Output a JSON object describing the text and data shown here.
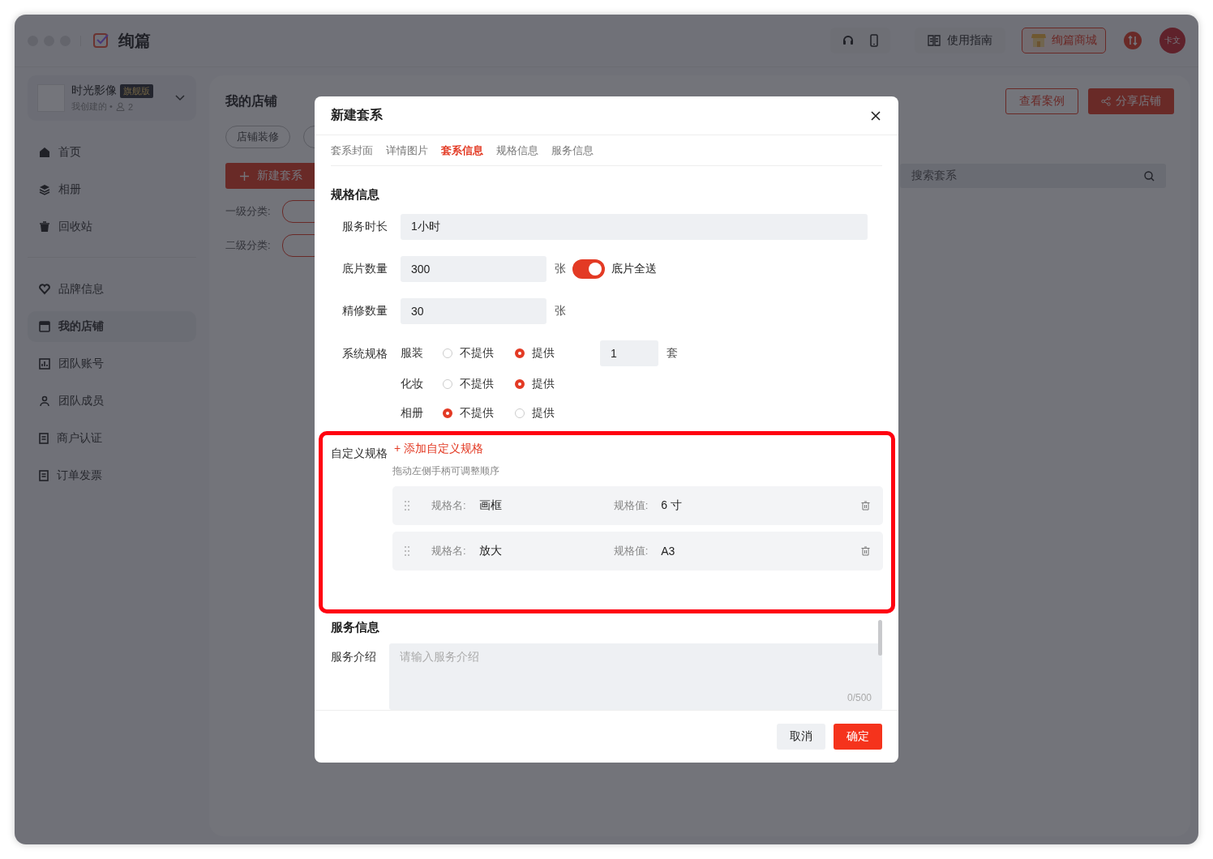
{
  "window": {
    "app_name": "绚篇"
  },
  "top_bar": {
    "guide_button": "使用指南",
    "mall_button": "绚篇商城",
    "avatar": "卡文"
  },
  "account": {
    "name": "时光影像",
    "badge": "旗舰版",
    "meta": "我创建的 •",
    "member_count": "2"
  },
  "sidebar": {
    "groups": [
      [
        {
          "label": "首页",
          "selected": false
        },
        {
          "label": "相册",
          "selected": false
        },
        {
          "label": "回收站",
          "selected": false
        }
      ],
      [
        {
          "label": "品牌信息",
          "selected": false
        },
        {
          "label": "我的店铺",
          "selected": true
        },
        {
          "label": "团队账号",
          "selected": false
        },
        {
          "label": "团队成员",
          "selected": false
        },
        {
          "label": "商户认证",
          "selected": false
        },
        {
          "label": "订单发票",
          "selected": false
        }
      ]
    ]
  },
  "main": {
    "title": "我的店铺",
    "tabs": [
      "店铺装修"
    ],
    "new_button": "新建套系",
    "filters": [
      "一级分类:",
      "二级分类:"
    ],
    "case_button": "查看案例",
    "share_button": "分享店铺",
    "search": {
      "placeholder": "搜索套系"
    }
  },
  "dialog": {
    "title": "新建套系",
    "tabs": [
      {
        "label": "套系封面",
        "selected": false
      },
      {
        "label": "详情图片",
        "selected": false
      },
      {
        "label": "套系信息",
        "selected": true
      },
      {
        "label": "规格信息",
        "selected": false
      },
      {
        "label": "服务信息",
        "selected": false
      }
    ],
    "section_title": "规格信息",
    "duration": {
      "label": "服务时长",
      "value": "1小时"
    },
    "raw_count": {
      "label": "底片数量",
      "value": "300",
      "unit": "张",
      "toggle": {
        "on": true,
        "label": "底片全送"
      }
    },
    "retouch_count": {
      "label": "精修数量",
      "value": "30",
      "unit": "张"
    },
    "system_spec": {
      "label": "系统规格",
      "rows": [
        {
          "name": "服装",
          "options": [
            {
              "label": "不提供",
              "selected": false
            },
            {
              "label": "提供",
              "selected": true
            }
          ],
          "quantity": "1",
          "unit": "套"
        },
        {
          "name": "化妆",
          "options": [
            {
              "label": "不提供",
              "selected": false
            },
            {
              "label": "提供",
              "selected": true
            }
          ]
        },
        {
          "name": "相册",
          "options": [
            {
              "label": "不提供",
              "selected": true
            },
            {
              "label": "提供",
              "selected": false
            }
          ]
        }
      ]
    },
    "custom_spec": {
      "label": "自定义规格",
      "add_link": "+ 添加自定义规格",
      "hint": "拖动左侧手柄可调整顺序",
      "items": [
        {
          "name_label": "规格名:",
          "name": "画框",
          "value_label": "规格值:",
          "value": "6 寸"
        },
        {
          "name_label": "规格名:",
          "name": "放大",
          "value_label": "规格值:",
          "value": "A3"
        }
      ]
    },
    "service": {
      "title": "服务信息",
      "intro_label": "服务介绍",
      "placeholder": "请输入服务介绍",
      "counter": "0/500"
    },
    "buttons": {
      "cancel": "取消",
      "confirm": "确定"
    }
  }
}
